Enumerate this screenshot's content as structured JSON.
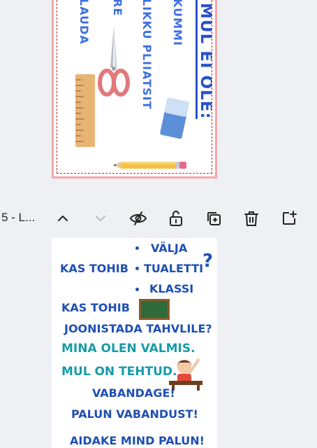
{
  "page_top": {
    "heading": "MUL EI OLE:",
    "item_1": "KUMMI",
    "item_2": "LIKKU PLIIATSIT",
    "item_3": "RE",
    "item_4": "LAUDA"
  },
  "toolbar": {
    "label": "5 - L..."
  },
  "page_bottom": {
    "q1": "KAS TOHIB",
    "options": [
      "VÄLJA",
      "TUALETTI",
      "KLASSI"
    ],
    "question_mark": "?",
    "q2_line1": "KAS TOHIB",
    "q2_line2": "JOONISTADA TAHVLILE?",
    "ready": "MINA OLEN VALMIS.",
    "done": "MUL ON TEHTUD.",
    "sorry": "VABANDAGE!",
    "pardon": "PALUN VABANDUST!",
    "help": "AIDAKE MIND PALUN!"
  },
  "colors": {
    "accent_blue": "#3f6fe0",
    "dark_blue": "#1e4fb3",
    "teal": "#159ca8",
    "selection_border": "#f4a7ad"
  }
}
